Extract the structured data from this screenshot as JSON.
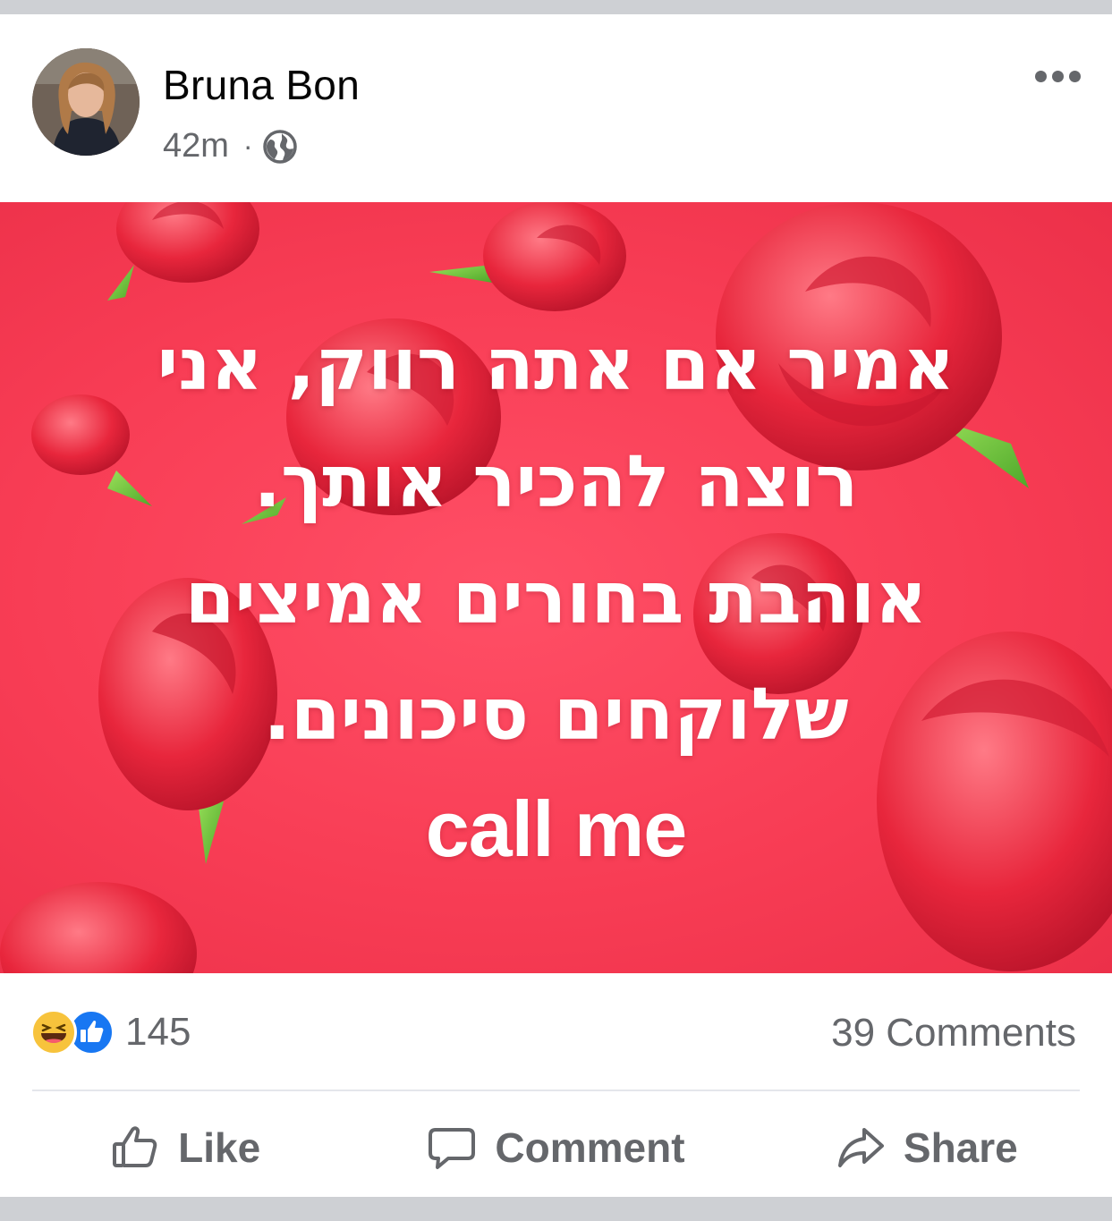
{
  "post": {
    "author": "Bruna Bon",
    "time": "42m",
    "separator": "·",
    "audience_icon": "globe-icon",
    "more_icon": "more-options-icon"
  },
  "image": {
    "background_color": "#f83d55",
    "lines": [
      "אמיר אם אתה רווק, אני",
      "רוצה להכיר אותך.",
      "אוהבת בחורים אמיצים",
      "שלוקחים סיכונים.",
      "call me"
    ]
  },
  "stats": {
    "reaction_icons": [
      "haha-icon",
      "like-icon"
    ],
    "reaction_count": "145",
    "comments": "39 Comments"
  },
  "actions": {
    "like": "Like",
    "comment": "Comment",
    "share": "Share"
  },
  "colors": {
    "secondary_text": "#65676b",
    "like_blue": "#1877f2",
    "haha_yellow": "#f7c33c"
  }
}
